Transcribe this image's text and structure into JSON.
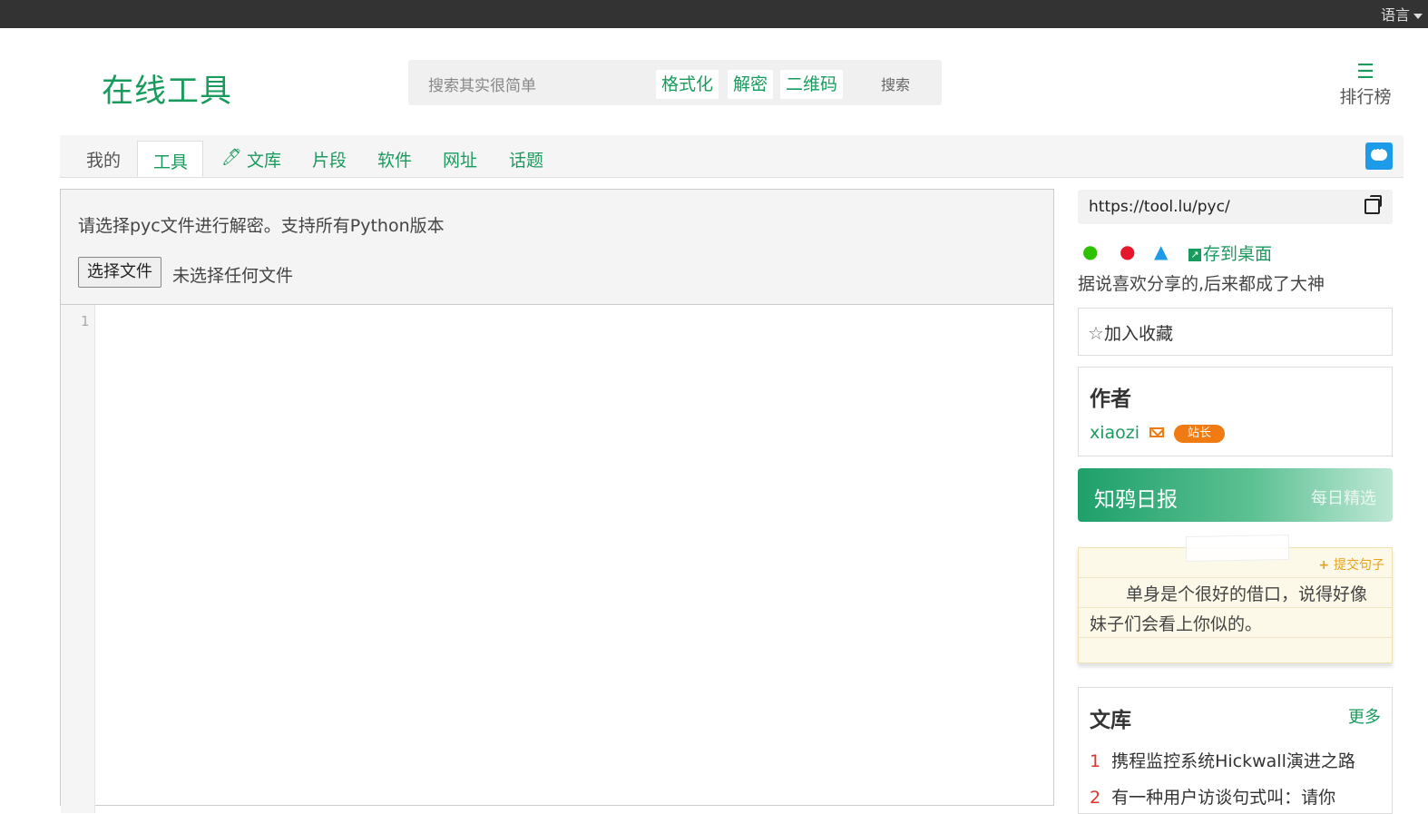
{
  "topbar": {
    "language": "语言"
  },
  "header": {
    "logo": "在线工具",
    "search_placeholder": "搜索其实很简单",
    "tags": [
      "格式化",
      "解密",
      "二维码"
    ],
    "search_button": "搜索",
    "ranking": "排行榜"
  },
  "nav": {
    "items": [
      "我的",
      "工具",
      "文库",
      "片段",
      "软件",
      "网址",
      "话题"
    ],
    "active": "工具"
  },
  "tool": {
    "instruction": "请选择pyc文件进行解密。支持所有Python版本",
    "file_button": "选择文件",
    "no_file": "未选择任何文件",
    "line_number": "1"
  },
  "sidebar": {
    "url": "https://tool.lu/pyc/",
    "save_desktop": "存到桌面",
    "share_text": "据说喜欢分享的,后来都成了大神",
    "favorite": "加入收藏",
    "author": {
      "heading": "作者",
      "name": "xiaozi",
      "badge": "站长"
    },
    "daily": {
      "title": "知鸦日报",
      "subtitle": "每日精选"
    },
    "quote": {
      "submit": "提交句子",
      "text": "单身是个很好的借口，说得好像妹子们会看上你似的。"
    },
    "library": {
      "heading": "文库",
      "more": "更多",
      "items": [
        {
          "num": "1",
          "title": "携程监控系统Hickwall演进之路"
        },
        {
          "num": "2",
          "title": "有一种用户访谈句式叫：请你"
        }
      ]
    }
  },
  "colors": {
    "brand": "#1a9b5e",
    "accent": "#f07b12",
    "chat": "#1e9be8"
  }
}
